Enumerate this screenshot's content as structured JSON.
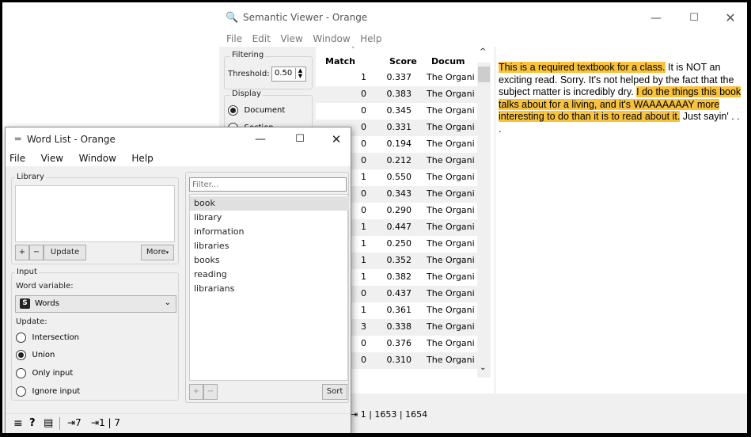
{
  "semantic_viewer": {
    "title": "Semantic Viewer - Orange",
    "menu": [
      "File",
      "Edit",
      "View",
      "Window",
      "Help"
    ],
    "filtering": {
      "group_label": "Filtering",
      "threshold_label": "Threshold:",
      "threshold_value": "0.50"
    },
    "display": {
      "group_label": "Display",
      "options": [
        "Document",
        "Section"
      ],
      "selected": "Document"
    },
    "table": {
      "columns": [
        "Match",
        "Score",
        "Docum"
      ],
      "rows": [
        {
          "match": "1",
          "score": "0.337",
          "doc": "The Organi"
        },
        {
          "match": "0",
          "score": "0.383",
          "doc": "The Organi"
        },
        {
          "match": "0",
          "score": "0.345",
          "doc": "The Organi"
        },
        {
          "match": "0",
          "score": "0.331",
          "doc": "The Organi"
        },
        {
          "match": "0",
          "score": "0.194",
          "doc": "The Organi"
        },
        {
          "match": "0",
          "score": "0.212",
          "doc": "The Organi"
        },
        {
          "match": "1",
          "score": "0.550",
          "doc": "The Organi"
        },
        {
          "match": "0",
          "score": "0.343",
          "doc": "The Organi"
        },
        {
          "match": "0",
          "score": "0.290",
          "doc": "The Organi"
        },
        {
          "match": "1",
          "score": "0.447",
          "doc": "The Organi"
        },
        {
          "match": "1",
          "score": "0.250",
          "doc": "The Organi"
        },
        {
          "match": "1",
          "score": "0.352",
          "doc": "The Organi"
        },
        {
          "match": "1",
          "score": "0.382",
          "doc": "The Organi"
        },
        {
          "match": "0",
          "score": "0.437",
          "doc": "The Organi"
        },
        {
          "match": "1",
          "score": "0.361",
          "doc": "The Organi"
        },
        {
          "match": "3",
          "score": "0.338",
          "doc": "The Organi"
        },
        {
          "match": "0",
          "score": "0.376",
          "doc": "The Organi"
        },
        {
          "match": "0",
          "score": "0.310",
          "doc": "The Organi"
        }
      ]
    },
    "document_text": {
      "highlight_1": "This is a required textbook for a class.",
      "plain_1": " It is NOT an exciting read. Sorry. It's not helped by the fact that the subject matter is incredibly dry. ",
      "highlight_2": "I do the things this book talks about for a living, and it's WAAAAAAAY more interesting to do than it is to read about it.",
      "plain_2": " Just sayin' . . ."
    },
    "status_text": "1 | 1653 | 1654",
    "highlight_color": "#f8c23c"
  },
  "word_list": {
    "title": "Word List - Orange",
    "menu": [
      "File",
      "View",
      "Window",
      "Help"
    ],
    "library": {
      "group_label": "Library",
      "add_label": "+",
      "remove_label": "−",
      "update_label": "Update",
      "more_label": "More"
    },
    "input": {
      "group_label": "Input",
      "word_variable_label": "Word variable:",
      "variable_badge": "S",
      "variable_value": "Words",
      "update_label": "Update:",
      "options": [
        "Intersection",
        "Union",
        "Only input",
        "Ignore input"
      ],
      "selected": "Union"
    },
    "filter_placeholder": "Filter...",
    "words": [
      "book",
      "library",
      "information",
      "libraries",
      "books",
      "reading",
      "librarians"
    ],
    "selected_word": "book",
    "sort_label": "Sort",
    "status": {
      "in_count": "7",
      "out_count": "1 | 7"
    }
  }
}
